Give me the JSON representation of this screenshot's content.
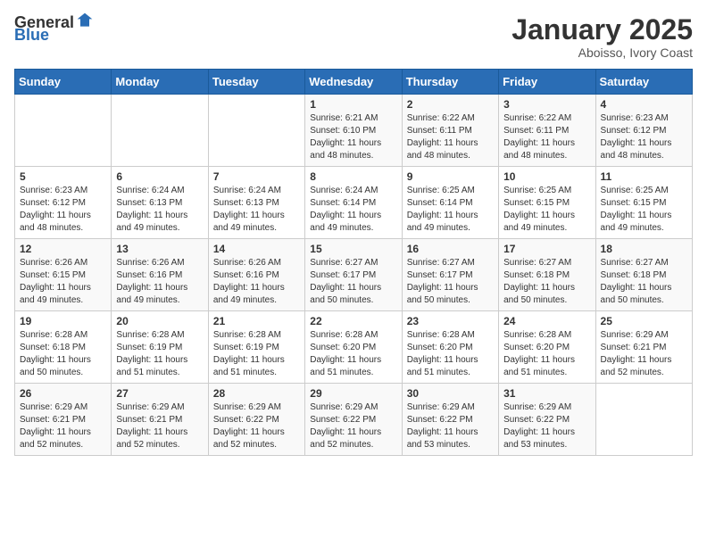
{
  "header": {
    "logo_general": "General",
    "logo_blue": "Blue",
    "month_title": "January 2025",
    "location": "Aboisso, Ivory Coast"
  },
  "days_of_week": [
    "Sunday",
    "Monday",
    "Tuesday",
    "Wednesday",
    "Thursday",
    "Friday",
    "Saturday"
  ],
  "weeks": [
    [
      {
        "day": "",
        "info": ""
      },
      {
        "day": "",
        "info": ""
      },
      {
        "day": "",
        "info": ""
      },
      {
        "day": "1",
        "info": "Sunrise: 6:21 AM\nSunset: 6:10 PM\nDaylight: 11 hours and 48 minutes."
      },
      {
        "day": "2",
        "info": "Sunrise: 6:22 AM\nSunset: 6:11 PM\nDaylight: 11 hours and 48 minutes."
      },
      {
        "day": "3",
        "info": "Sunrise: 6:22 AM\nSunset: 6:11 PM\nDaylight: 11 hours and 48 minutes."
      },
      {
        "day": "4",
        "info": "Sunrise: 6:23 AM\nSunset: 6:12 PM\nDaylight: 11 hours and 48 minutes."
      }
    ],
    [
      {
        "day": "5",
        "info": "Sunrise: 6:23 AM\nSunset: 6:12 PM\nDaylight: 11 hours and 48 minutes."
      },
      {
        "day": "6",
        "info": "Sunrise: 6:24 AM\nSunset: 6:13 PM\nDaylight: 11 hours and 49 minutes."
      },
      {
        "day": "7",
        "info": "Sunrise: 6:24 AM\nSunset: 6:13 PM\nDaylight: 11 hours and 49 minutes."
      },
      {
        "day": "8",
        "info": "Sunrise: 6:24 AM\nSunset: 6:14 PM\nDaylight: 11 hours and 49 minutes."
      },
      {
        "day": "9",
        "info": "Sunrise: 6:25 AM\nSunset: 6:14 PM\nDaylight: 11 hours and 49 minutes."
      },
      {
        "day": "10",
        "info": "Sunrise: 6:25 AM\nSunset: 6:15 PM\nDaylight: 11 hours and 49 minutes."
      },
      {
        "day": "11",
        "info": "Sunrise: 6:25 AM\nSunset: 6:15 PM\nDaylight: 11 hours and 49 minutes."
      }
    ],
    [
      {
        "day": "12",
        "info": "Sunrise: 6:26 AM\nSunset: 6:15 PM\nDaylight: 11 hours and 49 minutes."
      },
      {
        "day": "13",
        "info": "Sunrise: 6:26 AM\nSunset: 6:16 PM\nDaylight: 11 hours and 49 minutes."
      },
      {
        "day": "14",
        "info": "Sunrise: 6:26 AM\nSunset: 6:16 PM\nDaylight: 11 hours and 49 minutes."
      },
      {
        "day": "15",
        "info": "Sunrise: 6:27 AM\nSunset: 6:17 PM\nDaylight: 11 hours and 50 minutes."
      },
      {
        "day": "16",
        "info": "Sunrise: 6:27 AM\nSunset: 6:17 PM\nDaylight: 11 hours and 50 minutes."
      },
      {
        "day": "17",
        "info": "Sunrise: 6:27 AM\nSunset: 6:18 PM\nDaylight: 11 hours and 50 minutes."
      },
      {
        "day": "18",
        "info": "Sunrise: 6:27 AM\nSunset: 6:18 PM\nDaylight: 11 hours and 50 minutes."
      }
    ],
    [
      {
        "day": "19",
        "info": "Sunrise: 6:28 AM\nSunset: 6:18 PM\nDaylight: 11 hours and 50 minutes."
      },
      {
        "day": "20",
        "info": "Sunrise: 6:28 AM\nSunset: 6:19 PM\nDaylight: 11 hours and 51 minutes."
      },
      {
        "day": "21",
        "info": "Sunrise: 6:28 AM\nSunset: 6:19 PM\nDaylight: 11 hours and 51 minutes."
      },
      {
        "day": "22",
        "info": "Sunrise: 6:28 AM\nSunset: 6:20 PM\nDaylight: 11 hours and 51 minutes."
      },
      {
        "day": "23",
        "info": "Sunrise: 6:28 AM\nSunset: 6:20 PM\nDaylight: 11 hours and 51 minutes."
      },
      {
        "day": "24",
        "info": "Sunrise: 6:28 AM\nSunset: 6:20 PM\nDaylight: 11 hours and 51 minutes."
      },
      {
        "day": "25",
        "info": "Sunrise: 6:29 AM\nSunset: 6:21 PM\nDaylight: 11 hours and 52 minutes."
      }
    ],
    [
      {
        "day": "26",
        "info": "Sunrise: 6:29 AM\nSunset: 6:21 PM\nDaylight: 11 hours and 52 minutes."
      },
      {
        "day": "27",
        "info": "Sunrise: 6:29 AM\nSunset: 6:21 PM\nDaylight: 11 hours and 52 minutes."
      },
      {
        "day": "28",
        "info": "Sunrise: 6:29 AM\nSunset: 6:22 PM\nDaylight: 11 hours and 52 minutes."
      },
      {
        "day": "29",
        "info": "Sunrise: 6:29 AM\nSunset: 6:22 PM\nDaylight: 11 hours and 52 minutes."
      },
      {
        "day": "30",
        "info": "Sunrise: 6:29 AM\nSunset: 6:22 PM\nDaylight: 11 hours and 53 minutes."
      },
      {
        "day": "31",
        "info": "Sunrise: 6:29 AM\nSunset: 6:22 PM\nDaylight: 11 hours and 53 minutes."
      },
      {
        "day": "",
        "info": ""
      }
    ]
  ]
}
